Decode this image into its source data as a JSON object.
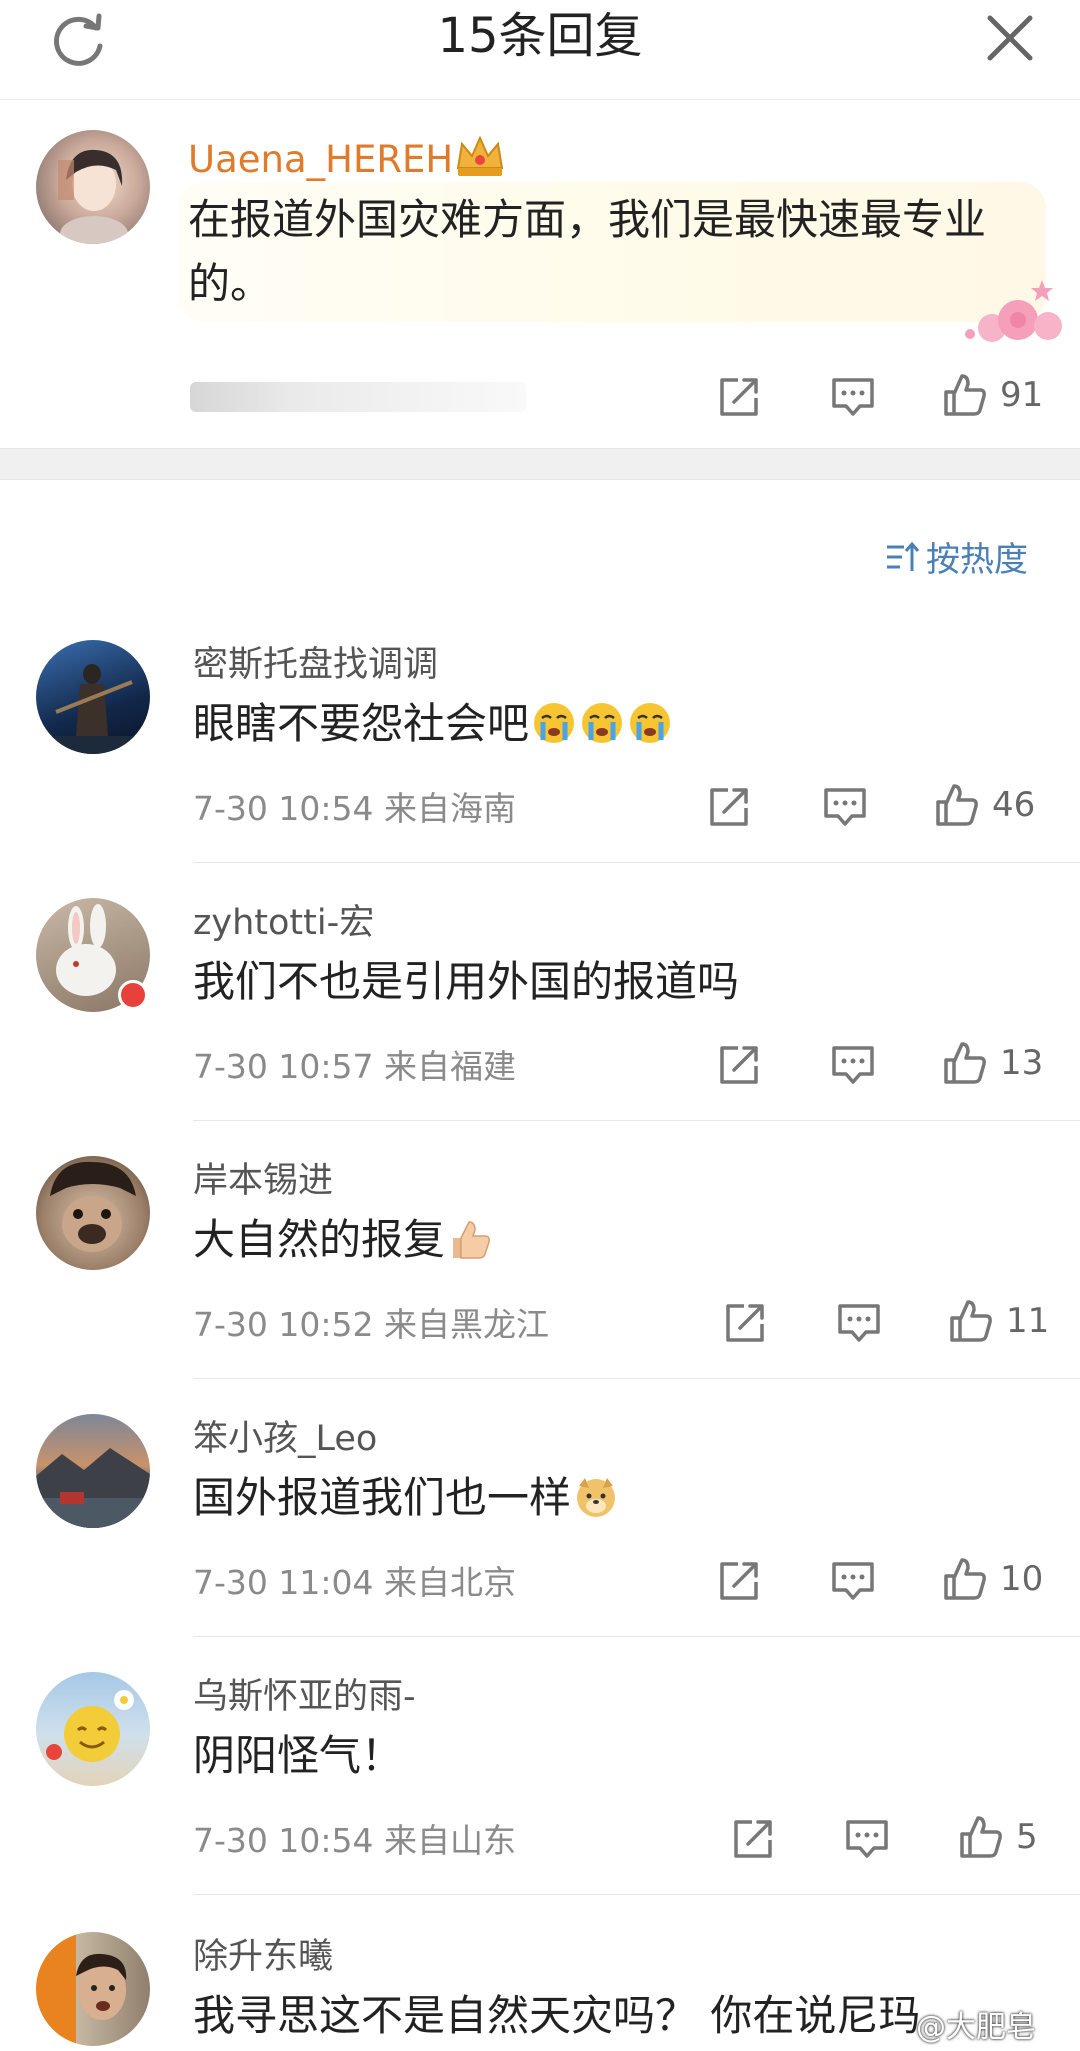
{
  "header": {
    "title": "15条回复",
    "refresh_icon": "refresh-icon",
    "close_icon": "close-icon"
  },
  "main_comment": {
    "username": "Uaena_HEREH",
    "text": "在报道外国灾难方面，我们是最快速最专业的。",
    "like_count": "91",
    "badge_icon": "crown-icon",
    "decoration_icon": "roses-icon"
  },
  "sort": {
    "label": "按热度",
    "icon": "sort-icon"
  },
  "replies": [
    {
      "username": "密斯托盘找调调",
      "text": "眼瞎不要怨社会吧",
      "emoji": [
        "crying-emoji",
        "crying-emoji",
        "crying-emoji"
      ],
      "time": "7-30 10:54",
      "location": "来自海南",
      "likes": "46"
    },
    {
      "username": "zyhtotti-宏",
      "text": "我们不也是引用外国的报道吗",
      "emoji": [],
      "time": "7-30 10:57",
      "location": "来自福建",
      "likes": "13"
    },
    {
      "username": "岸本锡进",
      "text": "大自然的报复",
      "emoji": [
        "thumbs-up-emoji"
      ],
      "time": "7-30 10:52",
      "location": "来自黑龙江",
      "likes": "11"
    },
    {
      "username": "笨小孩_Leo",
      "text": "国外报道我们也一样",
      "emoji": [
        "doge-emoji"
      ],
      "time": "7-30 11:04",
      "location": "来自北京",
      "likes": "10"
    },
    {
      "username": "乌斯怀亚的雨-",
      "text": "阴阳怪气！",
      "emoji": [],
      "time": "7-30 10:54",
      "location": "来自山东",
      "likes": "5"
    },
    {
      "username": "除升东曦",
      "text": "我寻思这不是自然天灾吗？ 你在说尼玛",
      "emoji": []
    }
  ],
  "watermark": "@大肥皂",
  "colors": {
    "username_orange": "#e07b2b",
    "sort_blue": "#4a7fb8",
    "meta_gray": "#8a8a8a",
    "icon_gray": "#777777",
    "separator": "#f0f0f0"
  }
}
